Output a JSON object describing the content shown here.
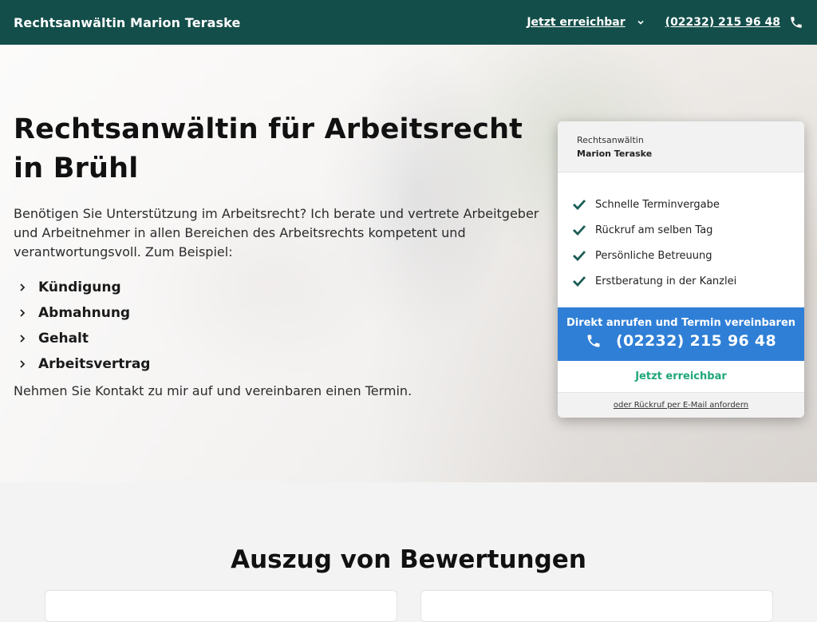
{
  "header": {
    "brand": "Rechtsanwältin Marion Teraske",
    "status_link": "Jetzt erreichbar",
    "phone": "(02232) 215 96 48"
  },
  "hero": {
    "title_line1": "Rechtsanwältin für Arbeitsrecht",
    "title_line2": "in Brühl",
    "intro": "Benötigen Sie Unterstützung im Arbeitsrecht? Ich berate und vertrete Arbeitgeber und Arbeitnehmer in allen Bereichen des Arbeitsrechts kompetent und verantwortungsvoll. Zum Beispiel:",
    "topics": [
      "Kündigung",
      "Abmahnung",
      "Gehalt",
      "Arbeitsvertrag"
    ],
    "outro": "Nehmen Sie Kontakt zu mir auf und vereinbaren einen Termin."
  },
  "card": {
    "subtitle": "Rechtsanwältin",
    "name": "Marion Teraske",
    "benefits": [
      "Schnelle Terminvergabe",
      "Rückruf am selben Tag",
      "Persönliche Betreuung",
      "Erstberatung in der Kanzlei"
    ],
    "call_label": "Direkt anrufen und Termin vereinbaren",
    "call_number": "(02232) 215 96 48",
    "availability": "Jetzt erreichbar",
    "email_link": "oder Rückruf per E-Mail anfordern"
  },
  "reviews": {
    "title": "Auszug von Bewertungen"
  },
  "colors": {
    "header_bg": "#134e4a",
    "call_button_bg": "#2f7fd6",
    "check_green": "#1a5c55",
    "availability_green": "#1fa67a"
  },
  "icons": {
    "header_dropdown": "chevron-down-icon",
    "header_phone": "phone-icon",
    "topic_marker": "chevron-right-icon",
    "benefit_marker": "check-icon",
    "call_phone": "phone-icon"
  }
}
